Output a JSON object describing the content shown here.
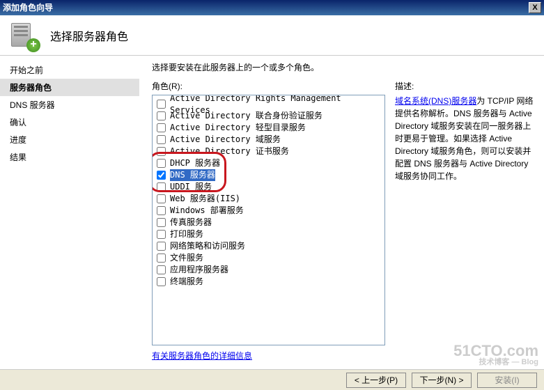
{
  "window": {
    "title": "添加角色向导",
    "close": "X"
  },
  "header": {
    "title": "选择服务器角色"
  },
  "sidebar": {
    "items": [
      {
        "label": "开始之前",
        "active": false
      },
      {
        "label": "服务器角色",
        "active": true
      },
      {
        "label": "DNS 服务器",
        "active": false
      },
      {
        "label": "确认",
        "active": false
      },
      {
        "label": "进度",
        "active": false
      },
      {
        "label": "结果",
        "active": false
      }
    ]
  },
  "content": {
    "instruction": "选择要安装在此服务器上的一个或多个角色。",
    "roles_label": "角色(R):",
    "roles": [
      {
        "label": "Active Directory Rights Management Services",
        "checked": false
      },
      {
        "label": "Active Directory 联合身份验证服务",
        "checked": false
      },
      {
        "label": "Active Directory 轻型目录服务",
        "checked": false
      },
      {
        "label": "Active Directory 域服务",
        "checked": false
      },
      {
        "label": "Active Directory 证书服务",
        "checked": false
      },
      {
        "label": "DHCP 服务器",
        "checked": false
      },
      {
        "label": "DNS 服务器",
        "checked": true,
        "selected": true
      },
      {
        "label": "UDDI 服务",
        "checked": false
      },
      {
        "label": "Web 服务器(IIS)",
        "checked": false
      },
      {
        "label": "Windows 部署服务",
        "checked": false
      },
      {
        "label": "传真服务器",
        "checked": false
      },
      {
        "label": "打印服务",
        "checked": false
      },
      {
        "label": "网络策略和访问服务",
        "checked": false
      },
      {
        "label": "文件服务",
        "checked": false
      },
      {
        "label": "应用程序服务器",
        "checked": false
      },
      {
        "label": "终端服务",
        "checked": false
      }
    ],
    "more_info": "有关服务器角色的详细信息"
  },
  "description": {
    "title": "描述:",
    "link_text": "域名系统(DNS)服务器",
    "body": "为 TCP/IP 网络提供名称解析。DNS 服务器与 Active Directory 域服务安装在同一服务器上时更易于管理。如果选择 Active Directory 域服务角色，则可以安装并配置 DNS 服务器与 Active Directory 域服务协同工作。"
  },
  "footer": {
    "prev": "< 上一步(P)",
    "next": "下一步(N) >",
    "install": "安装(I)"
  },
  "watermark": {
    "main": "51CTO.com",
    "sub": "技术博客 — Blog"
  }
}
